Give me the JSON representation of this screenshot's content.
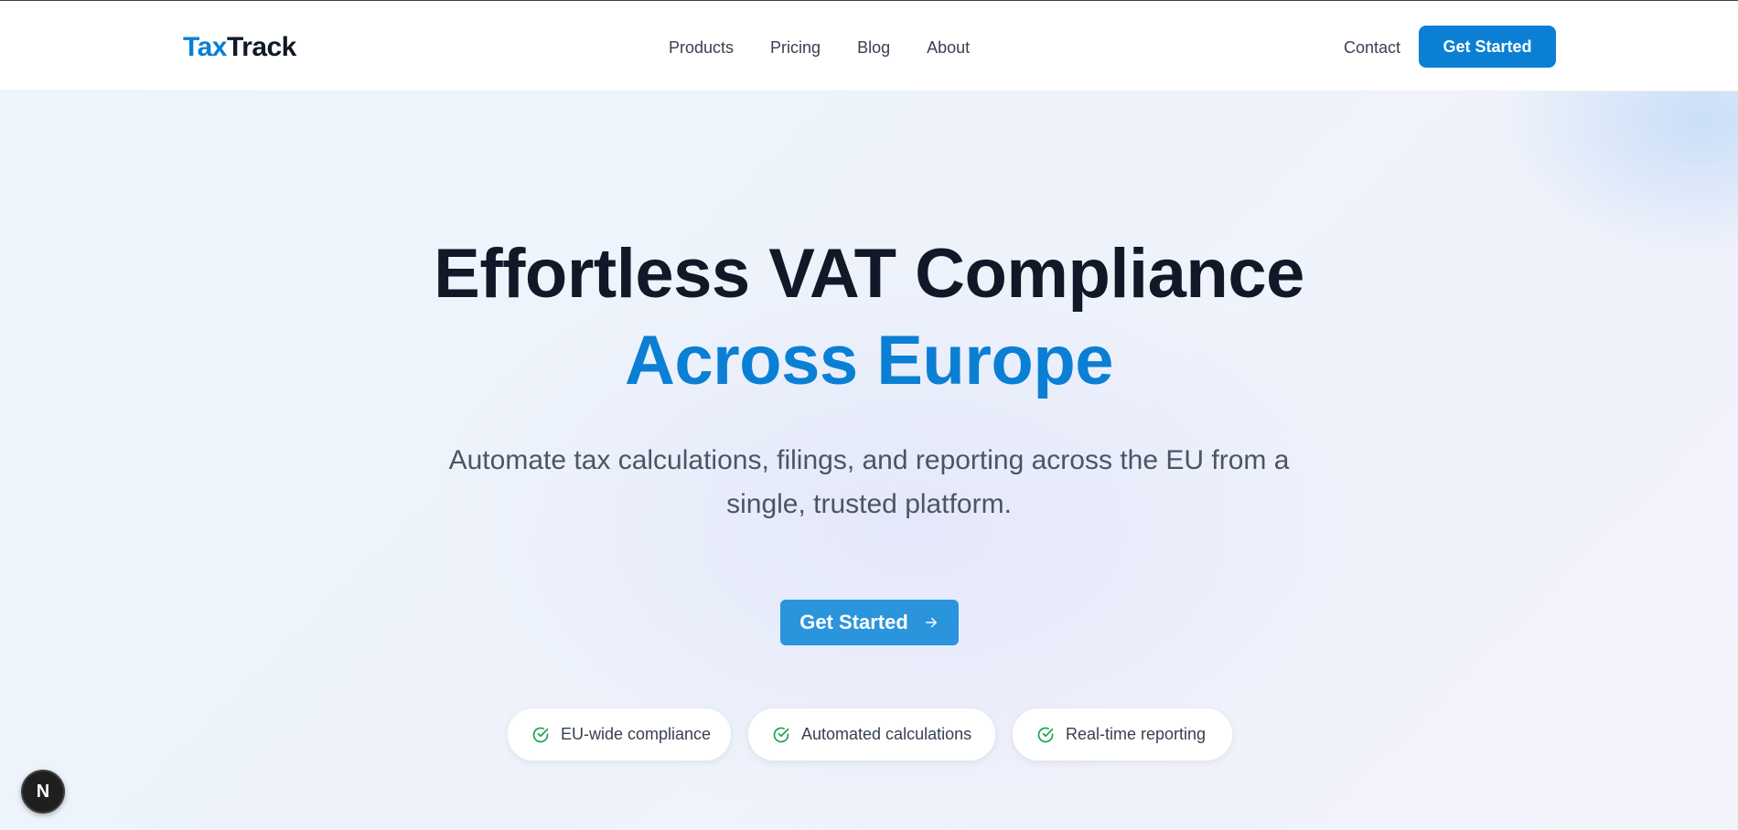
{
  "brand": {
    "logo_part1": "Tax",
    "logo_part2": "Track",
    "accent_color": "#0a7fd4"
  },
  "nav": {
    "links": [
      "Products",
      "Pricing",
      "Blog",
      "About"
    ],
    "contact_label": "Contact",
    "cta_label": "Get Started"
  },
  "hero": {
    "headline_line1": "Effortless VAT Compliance",
    "headline_line2": "Across Europe",
    "subtitle": "Automate tax calculations, filings, and reporting across the EU from a single, trusted platform.",
    "cta_label": "Get Started",
    "cta_icon": "arrow-right-icon"
  },
  "features": {
    "icon": "check-circle-icon",
    "check_color": "#16a34a",
    "items": [
      "EU-wide compliance",
      "Automated calculations",
      "Real-time reporting"
    ]
  },
  "dev_badge": {
    "label": "N"
  }
}
